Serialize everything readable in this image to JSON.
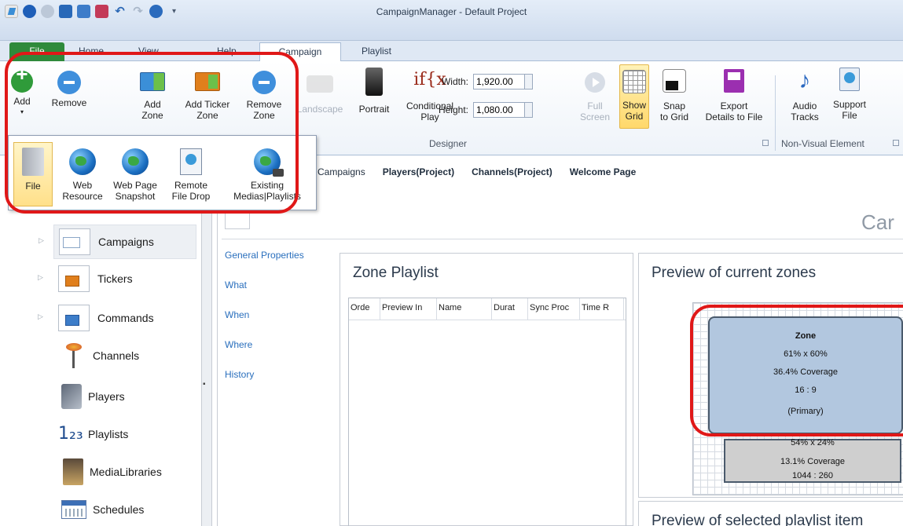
{
  "window": {
    "title": "CampaignManager - Default Project"
  },
  "quick_access": [
    "app-icon",
    "back-icon",
    "forward-icon",
    "save-icon",
    "save-all-icon",
    "save-as-icon",
    "undo-icon",
    "redo-icon",
    "help-icon",
    "customize-icon"
  ],
  "menu_tabs": {
    "file": "File",
    "home": "Home",
    "view": "View",
    "help": "Help",
    "campaign": "Campaign",
    "playlist": "Playlist"
  },
  "ribbon": {
    "add": "Add",
    "remove": "Remove",
    "add_zone": [
      "Add",
      "Zone"
    ],
    "add_ticker_zone": [
      "Add Ticker",
      "Zone"
    ],
    "remove_zone": [
      "Remove",
      "Zone"
    ],
    "landscape": "Landscape",
    "portrait": "Portrait",
    "conditional_play": [
      "Conditional",
      "Play"
    ],
    "conditional_icon_text": "if{x",
    "width_label": "Width:",
    "width_value": "1,920.00",
    "height_label": "Height:",
    "height_value": "1,080.00",
    "full_screen": [
      "Full",
      "Screen"
    ],
    "show_grid": [
      "Show",
      "Grid"
    ],
    "snap_to_grid": [
      "Snap",
      "to Grid"
    ],
    "export_details": [
      "Export",
      "Details to File"
    ],
    "audio_tracks": [
      "Audio",
      "Tracks"
    ],
    "support_file": [
      "Support",
      "File"
    ],
    "group_designer": "Designer",
    "group_non_visual": "Non-Visual Element"
  },
  "add_dropdown": {
    "file": "File",
    "web_resource": [
      "Web",
      "Resource"
    ],
    "web_page_snapshot": [
      "Web Page",
      "Snapshot"
    ],
    "remote_file_drop": [
      "Remote",
      "File Drop"
    ],
    "existing_medias": [
      "Existing",
      "Medias|Playlists"
    ]
  },
  "sub_tabs": [
    "Campaigns",
    "Players(Project)",
    "Channels(Project)",
    "Welcome Page"
  ],
  "sidebar": {
    "items": [
      {
        "label": "Campaigns",
        "icon": "campaign-thumb-icon"
      },
      {
        "label": "Tickers",
        "icon": "ticker-icon"
      },
      {
        "label": "Commands",
        "icon": "commands-icon"
      },
      {
        "label": "Channels",
        "icon": "antenna-icon"
      },
      {
        "label": "Players",
        "icon": "player-device-icon"
      },
      {
        "label": "Playlists",
        "icon": "playlists-123-icon"
      },
      {
        "label": "MediaLibraries",
        "icon": "media-library-icon"
      },
      {
        "label": "Schedules",
        "icon": "calendar-icon"
      }
    ]
  },
  "main": {
    "page_title_partial": "Car",
    "properties_nav": [
      "General Properties",
      "What",
      "When",
      "Where",
      "History"
    ],
    "zone_playlist": {
      "title": "Zone Playlist",
      "columns": [
        "Orde",
        "Preview In",
        "Name",
        "Durat",
        "Sync Proc",
        "Time R"
      ]
    },
    "preview_zones": {
      "title": "Preview of current zones",
      "primary_zone": {
        "name": "Zone",
        "size": "61% x 60%",
        "coverage": "36.4% Coverage",
        "ratio": "16 : 9",
        "tag": "(Primary)"
      },
      "ticker_zone": {
        "size": "54% x 24%",
        "coverage": "13.1% Coverage",
        "ratio": "1044 : 260"
      }
    },
    "preview_selected": {
      "title": "Preview of selected playlist item"
    }
  },
  "colors": {
    "file_tab": "#2f8a3b",
    "highlight": "#e01818",
    "link": "#2a6fbd",
    "zone_primary": "#b2c7df",
    "zone_secondary": "#cfcfcf"
  }
}
